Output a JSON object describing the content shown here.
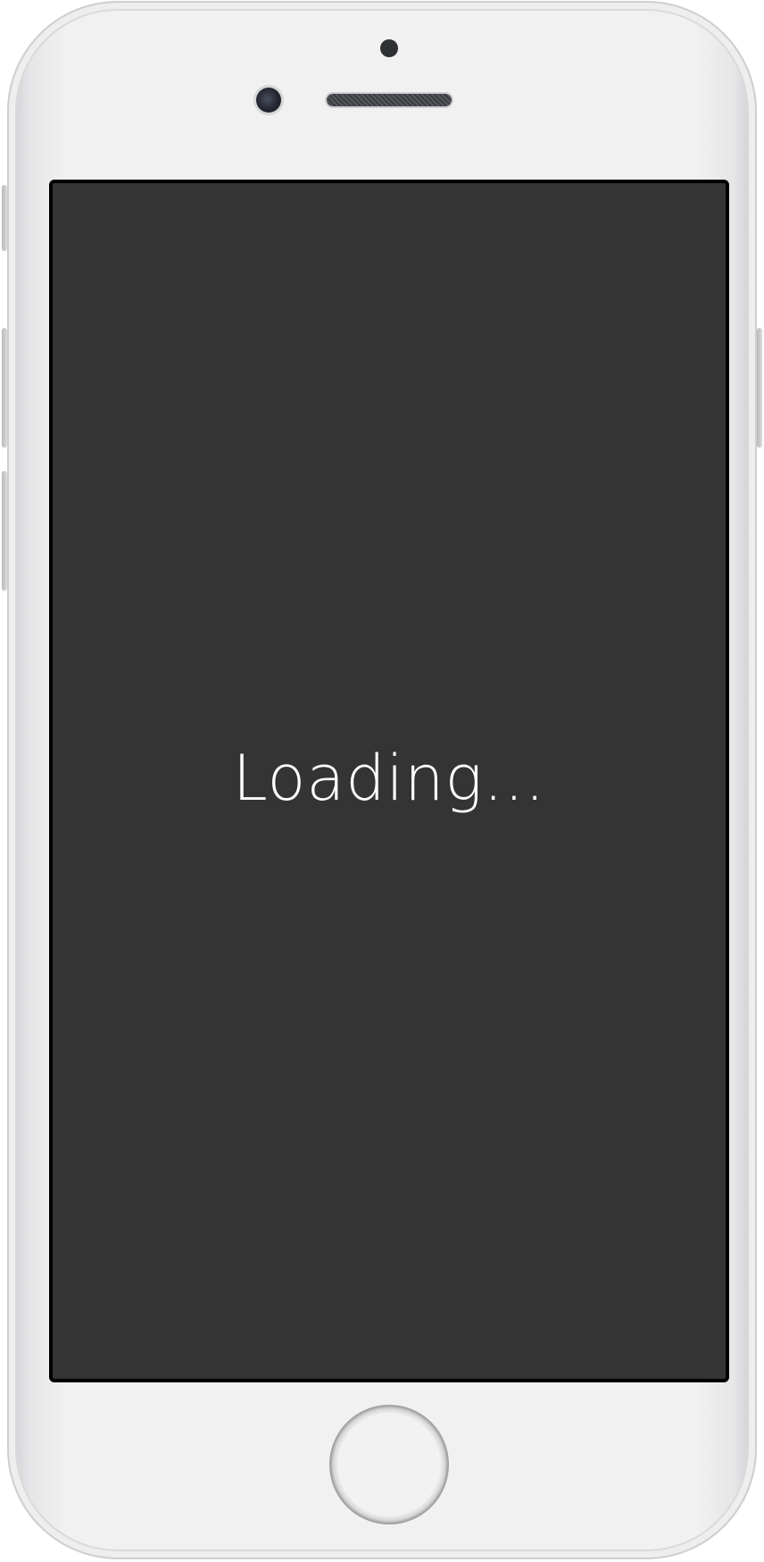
{
  "screen": {
    "status_text": "Loading..."
  },
  "colors": {
    "screen_background": "#343434",
    "device_body": "#f1f1f1",
    "text": "#ffffff"
  }
}
